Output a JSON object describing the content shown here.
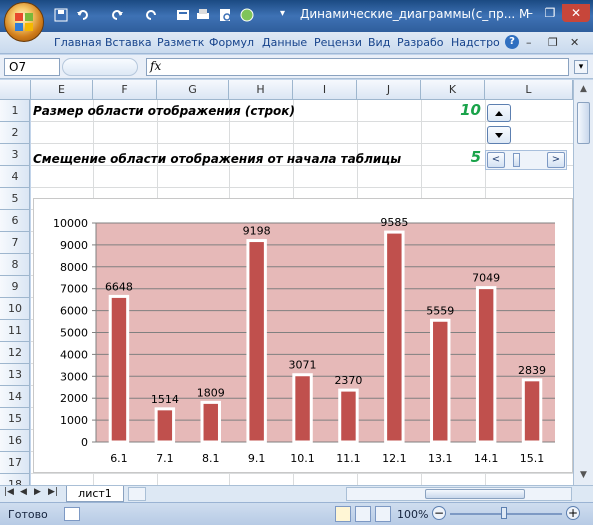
{
  "app": {
    "title": "Динамические_диаграммы(с_пр...",
    "title_suffix": "M"
  },
  "icons": [
    "office-button",
    "save-icon",
    "undo-icon",
    "redo-icon",
    "print-icon",
    "help-icon"
  ],
  "menu": {
    "tabs": [
      "Главная",
      "Вставка",
      "Разметк",
      "Формул",
      "Данные",
      "Рецензи",
      "Вид",
      "Разрабо",
      "Надстро"
    ]
  },
  "formula_bar": {
    "cell": "O7",
    "fx": "fx",
    "content": ""
  },
  "grid": {
    "columns": [
      "E",
      "F",
      "G",
      "H",
      "I",
      "J",
      "K",
      "L"
    ],
    "rows": [
      "1",
      "2",
      "3",
      "4",
      "5",
      "6",
      "7",
      "8",
      "9",
      "10",
      "11",
      "12",
      "13",
      "14",
      "15",
      "16",
      "17",
      "18"
    ]
  },
  "cells": {
    "row1_label": "Размер области отображения (строк)",
    "row1_value": "10",
    "row3_label": "Смещение области отображения от начала таблицы",
    "row3_value": "5"
  },
  "chart_data": {
    "type": "bar",
    "categories": [
      "6.1",
      "7.1",
      "8.1",
      "9.1",
      "10.1",
      "11.1",
      "12.1",
      "13.1",
      "14.1",
      "15.1"
    ],
    "values": [
      6648,
      1514,
      1809,
      9198,
      3071,
      2370,
      9585,
      5559,
      7049,
      2839
    ],
    "ylim": [
      0,
      10000
    ],
    "yticks": [
      0,
      1000,
      2000,
      3000,
      4000,
      5000,
      6000,
      7000,
      8000,
      9000,
      10000
    ],
    "grid": true,
    "colors": {
      "plot_bg": "#e6b9b8",
      "bar_fill": "#c0504d",
      "bar_border": "#ffffff"
    }
  },
  "sheet_tab": {
    "name": "лист1"
  },
  "status": {
    "ready": "Готово",
    "zoom": "100%"
  }
}
